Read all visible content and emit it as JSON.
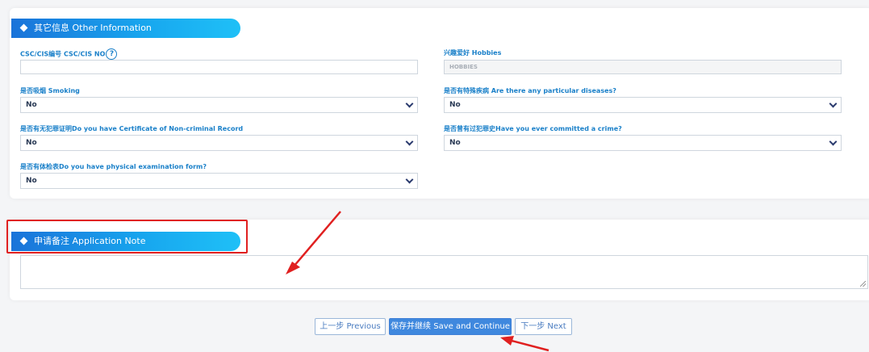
{
  "other_info": {
    "title": "其它信息 Other Information",
    "csc_label": "CSC/CIS编号 CSC/CIS NO",
    "csc_help": "?",
    "csc_value": "",
    "hobbies_label": "兴趣爱好 Hobbies",
    "hobbies_placeholder": "HOBBIES",
    "smoking_label": "是否吸烟 Smoking",
    "smoking_value": "No",
    "diseases_label": "是否有特殊疾病 Are there any particular diseases?",
    "diseases_value": "No",
    "noncriminal_label": "是否有无犯罪证明Do you have Certificate of Non-criminal Record",
    "noncriminal_value": "No",
    "crime_label": "是否曾有过犯罪史Have you ever committed a crime?",
    "crime_value": "No",
    "physical_label": "是否有体检表Do you have physical examination form?",
    "physical_value": "No"
  },
  "application_note": {
    "title": "申请备注 Application Note",
    "value": ""
  },
  "buttons": {
    "previous": "上一步 Previous",
    "save_continue": "保存并继续 Save and Continue",
    "next": "下一步 Next"
  },
  "colors": {
    "label_blue": "#1a80c9",
    "header_gradient_start": "#1a73d9",
    "header_gradient_end": "#1fc0f7",
    "annotation_red": "#e02020",
    "primary_button": "#3f88de"
  }
}
